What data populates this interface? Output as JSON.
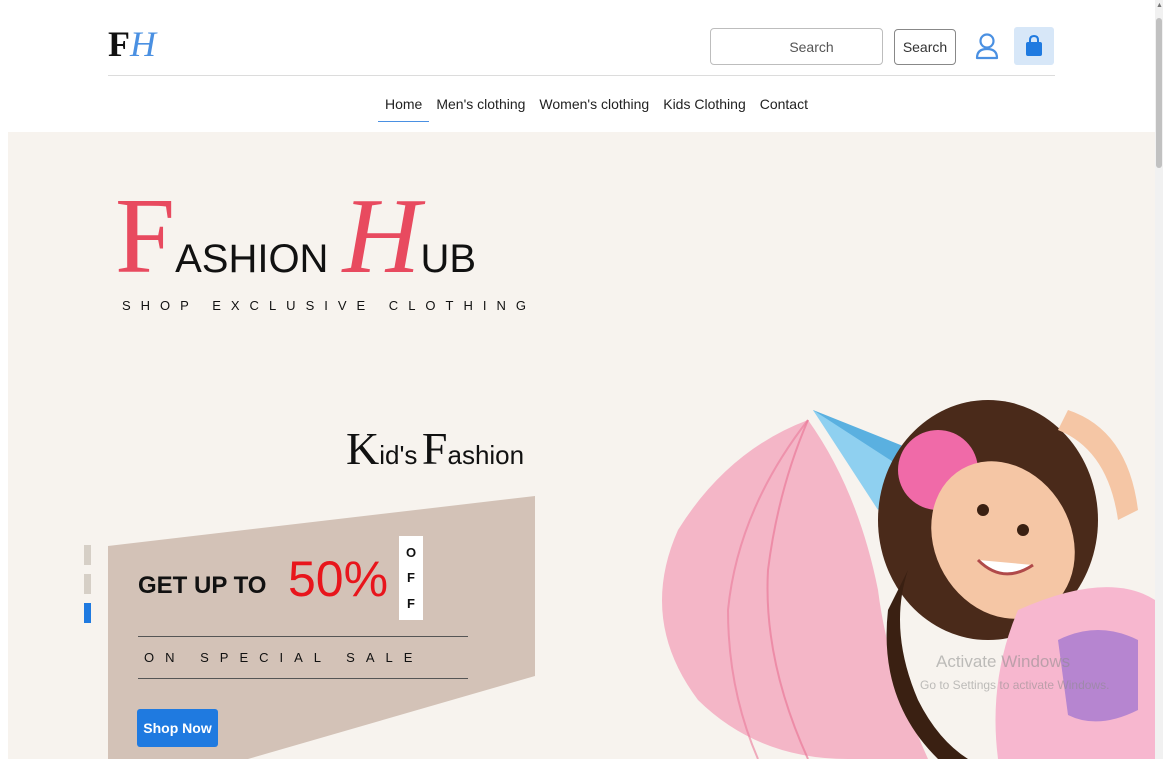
{
  "header": {
    "logo": {
      "f": "F",
      "h": "H"
    },
    "search": {
      "placeholder": "Search",
      "button_label": "Search"
    },
    "nav": [
      {
        "label": "Home",
        "active": true
      },
      {
        "label": "Men's clothing"
      },
      {
        "label": "Women's clothing"
      },
      {
        "label": "Kids Clothing"
      },
      {
        "label": "Contact"
      }
    ]
  },
  "hero": {
    "brand": {
      "f_cap": "F",
      "f_rest": "ASHION",
      "h_cap": "H",
      "h_rest": "UB"
    },
    "tagline": "SHOP EXCLUSIVE CLOTHING",
    "kids_title": {
      "k_cap": "K",
      "k_rest": "id's",
      "f_cap": "F",
      "f_rest": "ashion"
    },
    "promo": {
      "get_up_to": "GET UP TO",
      "percent": "50%",
      "off": [
        "O",
        "F",
        "F"
      ],
      "special": "ON SPECIAL SALE",
      "shop_button": "Shop Now"
    },
    "slides": {
      "count": 3,
      "active_index": 2
    },
    "image_alt": "Smiling girl in birthday party hat and pink tutu"
  },
  "watermark": {
    "line1": "Activate Windows",
    "line2": "Go to Settings to activate Windows."
  },
  "colors": {
    "accent": "#1f7ae0",
    "brand_red": "#e84a5f",
    "sale_red": "#e8151c",
    "promo_bg": "#d3c2b7",
    "hero_bg": "#f7f3ee"
  }
}
